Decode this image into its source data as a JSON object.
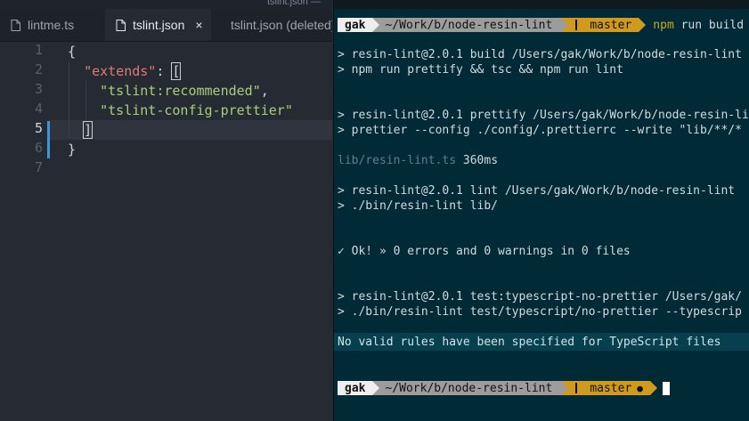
{
  "window": {
    "title": "tslint.json —"
  },
  "editor": {
    "tabs": [
      {
        "label": "lintme.ts",
        "active": false
      },
      {
        "label": "tslint.json",
        "active": true,
        "close": "×"
      },
      {
        "label": "tslint.json (deleted)",
        "active": false
      }
    ],
    "line_numbers": [
      "1",
      "2",
      "3",
      "4",
      "5",
      "6",
      "7"
    ],
    "current_line": "5",
    "code": {
      "l1": "{",
      "l2_key": "\"extends\"",
      "l2_sep": ": ",
      "l2_open": "[",
      "l3_str": "\"tslint:recommended\"",
      "l3_comma": ",",
      "l4_str": "\"tslint-config-prettier\"",
      "l5_close": "]",
      "l6": "}"
    }
  },
  "terminal": {
    "prompt1": {
      "user": "gak",
      "path": "~/Work/b/node-resin-lint",
      "branch": "master",
      "command": "npm",
      "command_rest": " run build"
    },
    "lines": [
      "> resin-lint@2.0.1 build /Users/gak/Work/b/node-resin-lint",
      "> npm run prettify && tsc && npm run lint",
      "> resin-lint@2.0.1 prettify /Users/gak/Work/b/node-resin-lint",
      "> prettier --config ./config/.prettierrc --write \"lib/**/*",
      "lib/resin-lint.ts",
      " 360ms",
      "> resin-lint@2.0.1 lint /Users/gak/Work/b/node-resin-lint",
      "> ./bin/resin-lint lib/",
      "✓ Ok! » 0 errors and 0 warnings in 0 files",
      "> resin-lint@2.0.1 test:typescript-no-prettier /Users/gak/",
      "> ./bin/resin-lint test/typescript/no-prettier --typescrip",
      "No valid rules have been specified for TypeScript files"
    ],
    "prompt2": {
      "user": "gak",
      "path": "~/Work/b/node-resin-lint",
      "branch": "master",
      "dirty": "●"
    }
  }
}
